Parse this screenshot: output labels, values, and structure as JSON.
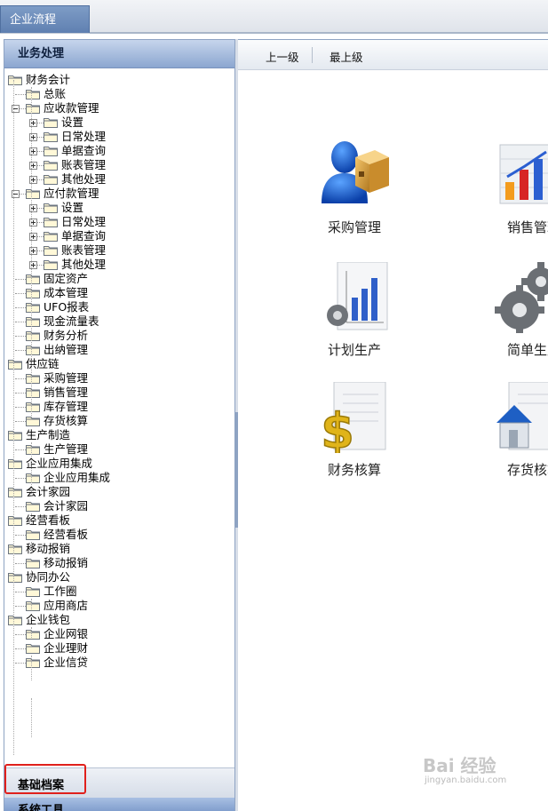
{
  "window": {
    "tab_title": "企业流程"
  },
  "left_panel": {
    "header": "业务处理",
    "tree": [
      {
        "label": "财务会计",
        "level": 0
      },
      {
        "label": "总账",
        "level": 1
      },
      {
        "label": "应收款管理",
        "level": 1,
        "expander": "minus"
      },
      {
        "label": "设置",
        "level": 2,
        "expander": "plus"
      },
      {
        "label": "日常处理",
        "level": 2,
        "expander": "plus"
      },
      {
        "label": "单据查询",
        "level": 2,
        "expander": "plus"
      },
      {
        "label": "账表管理",
        "level": 2,
        "expander": "plus"
      },
      {
        "label": "其他处理",
        "level": 2,
        "expander": "plus"
      },
      {
        "label": "应付款管理",
        "level": 1,
        "expander": "minus"
      },
      {
        "label": "设置",
        "level": 2,
        "expander": "plus"
      },
      {
        "label": "日常处理",
        "level": 2,
        "expander": "plus"
      },
      {
        "label": "单据查询",
        "level": 2,
        "expander": "plus"
      },
      {
        "label": "账表管理",
        "level": 2,
        "expander": "plus"
      },
      {
        "label": "其他处理",
        "level": 2,
        "expander": "plus"
      },
      {
        "label": "固定资产",
        "level": 1
      },
      {
        "label": "成本管理",
        "level": 1
      },
      {
        "label": "UFO报表",
        "level": 1
      },
      {
        "label": "现金流量表",
        "level": 1
      },
      {
        "label": "财务分析",
        "level": 1
      },
      {
        "label": "出纳管理",
        "level": 1
      },
      {
        "label": "供应链",
        "level": 0
      },
      {
        "label": "采购管理",
        "level": 1
      },
      {
        "label": "销售管理",
        "level": 1
      },
      {
        "label": "库存管理",
        "level": 1
      },
      {
        "label": "存货核算",
        "level": 1
      },
      {
        "label": "生产制造",
        "level": 0
      },
      {
        "label": "生产管理",
        "level": 1
      },
      {
        "label": "企业应用集成",
        "level": 0
      },
      {
        "label": "企业应用集成",
        "level": 1
      },
      {
        "label": "会计家园",
        "level": 0
      },
      {
        "label": "会计家园",
        "level": 1
      },
      {
        "label": "经营看板",
        "level": 0
      },
      {
        "label": "经营看板",
        "level": 1
      },
      {
        "label": "移动报销",
        "level": 0
      },
      {
        "label": "移动报销",
        "level": 1
      },
      {
        "label": "协同办公",
        "level": 0
      },
      {
        "label": "工作圈",
        "level": 1
      },
      {
        "label": "应用商店",
        "level": 1
      },
      {
        "label": "企业钱包",
        "level": 0
      },
      {
        "label": "企业网银",
        "level": 1
      },
      {
        "label": "企业理财",
        "level": 1
      },
      {
        "label": "企业信贷",
        "level": 1
      }
    ],
    "footer_primary": "基础档案",
    "footer_secondary": "系统工具"
  },
  "toolbar": {
    "up_label": "上一级",
    "top_label": "最上级"
  },
  "tiles": [
    {
      "label": "采购管理",
      "icon": "purchase-person-box-icon"
    },
    {
      "label": "销售管理",
      "icon": "sales-bar-chart-icon"
    },
    {
      "label": "计划生产",
      "icon": "plan-chart-gear-icon"
    },
    {
      "label": "简单生产",
      "icon": "gears-icon"
    },
    {
      "label": "财务核算",
      "icon": "dollar-document-icon"
    },
    {
      "label": "存货核算",
      "icon": "house-document-icon"
    }
  ],
  "watermark": {
    "main": "Bai 经验",
    "sub": "jingyan.baidu.com"
  },
  "colors": {
    "highlight_border": "#e0201c",
    "header_blue": "#8ba6d0"
  }
}
